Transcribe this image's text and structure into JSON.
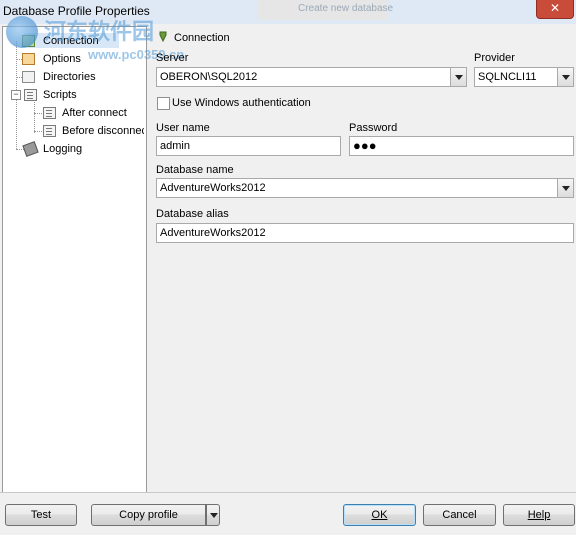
{
  "window": {
    "title": "Database Profile Properties",
    "close_glyph": "✕",
    "background_tab_text": "Create new database"
  },
  "watermark": {
    "line1": "河东软件园",
    "line2": "www.pc0359.cn"
  },
  "tree": {
    "items": [
      {
        "label": "Connection",
        "icon": "connection-icon",
        "selected": true
      },
      {
        "label": "Options",
        "icon": "options-icon"
      },
      {
        "label": "Directories",
        "icon": "folder-icon"
      },
      {
        "label": "Scripts",
        "icon": "scripts-icon",
        "expanded": true
      },
      {
        "label": "After connect",
        "icon": "script-doc-icon"
      },
      {
        "label": "Before disconnect",
        "icon": "script-doc-icon"
      },
      {
        "label": "Logging",
        "icon": "logging-icon"
      }
    ],
    "expander_minus": "−"
  },
  "panel": {
    "header": "Connection",
    "server": {
      "label": "Server",
      "value": "OBERON\\SQL2012"
    },
    "provider": {
      "label": "Provider",
      "value": "SQLNCLI11"
    },
    "windows_auth": {
      "label": "Use Windows authentication",
      "checked": false
    },
    "username": {
      "label": "User name",
      "value": "admin"
    },
    "password": {
      "label": "Password",
      "value": "●●●"
    },
    "database_name": {
      "label": "Database name",
      "value": "AdventureWorks2012"
    },
    "database_alias": {
      "label": "Database alias",
      "value": "AdventureWorks2012"
    }
  },
  "buttons": {
    "test": "Test",
    "copy_profile": "Copy profile",
    "ok": "OK",
    "cancel": "Cancel",
    "help": "Help"
  }
}
